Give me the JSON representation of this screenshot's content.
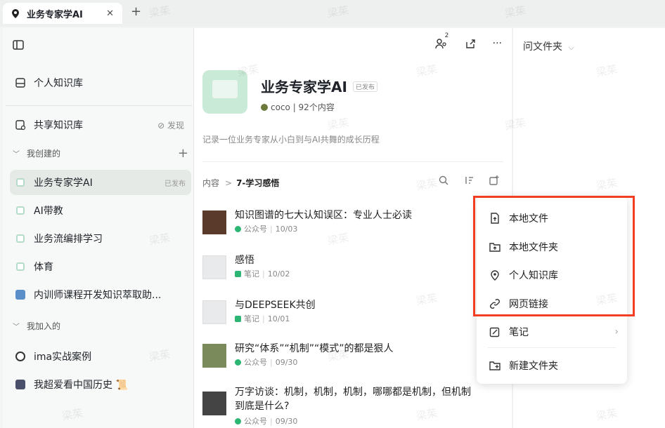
{
  "tab": {
    "title": "业务专家学AI",
    "close": "✕",
    "new": "+"
  },
  "sidebar": {
    "personal": "个人知识库",
    "shared": "共享知识库",
    "discover": "⊘ 发现",
    "created_group": "我创建的",
    "joined_group": "我加入的",
    "created_items": [
      {
        "label": "业务专家学AI",
        "tag": "已发布"
      },
      {
        "label": "AI带教"
      },
      {
        "label": "业务流编排学习"
      },
      {
        "label": "体育"
      },
      {
        "label": "内训师课程开发知识萃取助..."
      }
    ],
    "joined_items": [
      {
        "label": "ima实战案例"
      },
      {
        "label": "我超爱看中国历史 📜"
      }
    ]
  },
  "main": {
    "title": "业务专家学AI",
    "badge": "已发布",
    "meta": "coco | 92个内容",
    "desc": "记录一位业务专家从小白到与AI共舞的成长历程",
    "crumb_root": "内容",
    "crumb_sep": ">",
    "crumb_current": "7-学习感悟",
    "user_count": "2",
    "items": [
      {
        "name": "知识图谱的七大认知误区：专业人士必读",
        "source": "公众号",
        "date": "10/03",
        "kind": "wechat"
      },
      {
        "name": "感悟",
        "source": "笔记",
        "date": "10/02",
        "kind": "note"
      },
      {
        "name": "与DEEPSEEK共创",
        "source": "笔记",
        "date": "10/01",
        "kind": "note"
      },
      {
        "name": "研究“体系”“机制”“模式”的都是狠人",
        "source": "公众号",
        "date": "09/30",
        "kind": "wechat"
      },
      {
        "name": "万字访谈：机制，机制，机制，哪哪都是机制，但机制",
        "name2": "到底是什么?",
        "source": "公众号",
        "date": "09/30",
        "kind": "wechat"
      }
    ]
  },
  "right": {
    "label": "问文件夹"
  },
  "menu": {
    "items": [
      "本地文件",
      "本地文件夹",
      "个人知识库",
      "网页链接",
      "笔记",
      "新建文件夹"
    ]
  },
  "watermark": "梁茱",
  "colors": {
    "accent_green": "#2bb673",
    "highlight_red": "#f23f23"
  }
}
